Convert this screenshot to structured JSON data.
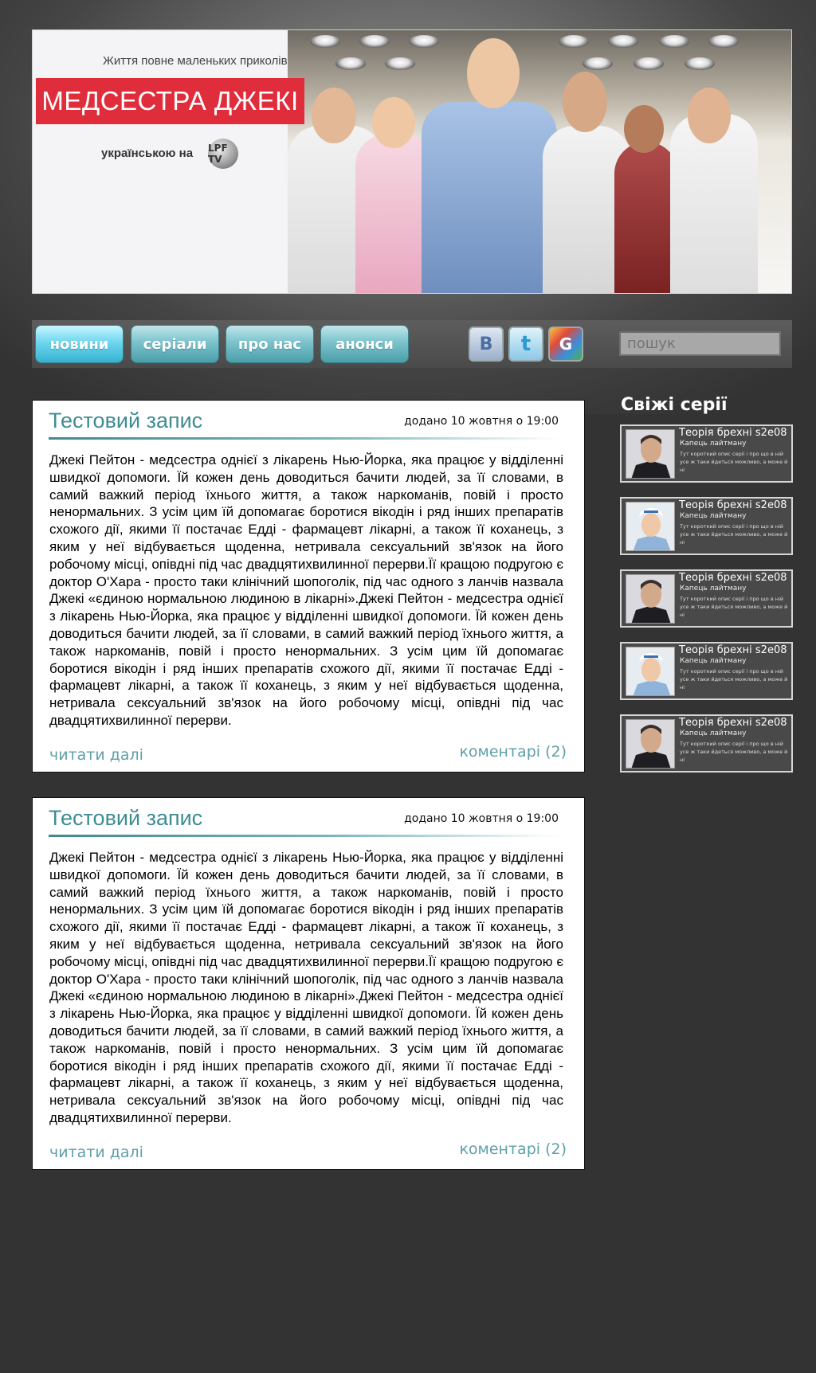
{
  "banner": {
    "tagline": "Життя повне маленьких приколів",
    "logo": "МЕДСЕСТРА ДЖЕКІ",
    "subtitle": "українською на",
    "channel": "LPF TV"
  },
  "nav": {
    "items": [
      {
        "label": "новини"
      },
      {
        "label": "серіали"
      },
      {
        "label": "про нас"
      },
      {
        "label": "анонси"
      }
    ],
    "social": [
      "В",
      "t",
      "G"
    ],
    "search_placeholder": "пошук"
  },
  "posts": [
    {
      "title": "Тестовий запис",
      "date": "додано 10 жовтня о 19:00",
      "text": "Джекі Пейтон - медсестра однієї з лікарень Нью-Йорка, яка працює у відділенні швидкої допомоги. Їй кожен день доводиться бачити людей, за її словами, в самий важкий період їхнього життя, а також наркоманів, повій і просто ненормальних. З усім цим їй допомагає боротися вікодін і ряд інших препаратів схожого дії, якими її постачає Едді - фармацевт лікарні, а також її коханець, з яким у неї відбувається щоденна, нетривала сексуальний зв'язок на його робочому місці, опівдні під час двадцятихвилинної перерви.Її кращою подругою є доктор О'Хара - просто таки клінічний шопоголік, під час одного з ланчів назвала Джекі «єдиною нормальною людиною в лікарні».Джекі Пейтон - медсестра однієї з лікарень Нью-Йорка, яка працює у відділенні швидкої допомоги. Їй кожен день доводиться бачити людей, за її словами, в самий важкий період їхнього життя, а також наркоманів, повій і просто ненормальних. З усім цим їй допомагає боротися вікодін і ряд інших препаратів схожого дії, якими її постачає Едді - фармацевт лікарні, а також її коханець, з яким у неї відбувається щоденна, нетривала сексуальний зв'язок на його робочому місці, опівдні під час двадцятихвилинної перерви.",
      "read_more": "читати далі",
      "comments": "коментарі (2)"
    },
    {
      "title": "Тестовий запис",
      "date": "додано 10 жовтня о 19:00",
      "text": "Джекі Пейтон - медсестра однієї з лікарень Нью-Йорка, яка працює у відділенні швидкої допомоги. Їй кожен день доводиться бачити людей, за її словами, в самий важкий період їхнього життя, а також наркоманів, повій і просто ненормальних. З усім цим їй допомагає боротися вікодін і ряд інших препаратів схожого дії, якими її постачає Едді - фармацевт лікарні, а також її коханець, з яким у неї відбувається щоденна, нетривала сексуальний зв'язок на його робочому місці, опівдні під час двадцятихвилинної перерви.Її кращою подругою є доктор О'Хара - просто таки клінічний шопоголік, під час одного з ланчів назвала Джекі «єдиною нормальною людиною в лікарні».Джекі Пейтон - медсестра однієї з лікарень Нью-Йорка, яка працює у відділенні швидкої допомоги. Їй кожен день доводиться бачити людей, за її словами, в самий важкий період їхнього життя, а також наркоманів, повій і просто ненормальних. З усім цим їй допомагає боротися вікодін і ряд інших препаратів схожого дії, якими її постачає Едді - фармацевт лікарні, а також її коханець, з яким у неї відбувається щоденна, нетривала сексуальний зв'язок на його робочому місці, опівдні під час двадцятихвилинної перерви.",
      "read_more": "читати далі",
      "comments": "коментарі (2)"
    }
  ],
  "sidebar": {
    "title": "Свіжі серії",
    "episodes": [
      {
        "title": "Теорія брехні s2e08",
        "subtitle": "Капець лайтману",
        "desc": "Тут короткий опис серії і про що в ній усе ж таки йдеться можливо, а може й ні",
        "thumb": "man"
      },
      {
        "title": "Теорія брехні s2e08",
        "subtitle": "Капець лайтману",
        "desc": "Тут короткий опис серії і про що в ній усе ж таки йдеться можливо, а може й ні",
        "thumb": "nurse"
      },
      {
        "title": "Теорія брехні s2e08",
        "subtitle": "Капець лайтману",
        "desc": "Тут короткий опис серії і про що в ній усе ж таки йдеться можливо, а може й ні",
        "thumb": "man"
      },
      {
        "title": "Теорія брехні s2e08",
        "subtitle": "Капець лайтману",
        "desc": "Тут короткий опис серії і про що в ній усе ж таки йдеться можливо, а може й ні",
        "thumb": "nurse"
      },
      {
        "title": "Теорія брехні s2e08",
        "subtitle": "Капець лайтману",
        "desc": "Тут короткий опис серії і про що в ній усе ж таки йдеться можливо, а може й ні",
        "thumb": "man"
      }
    ]
  },
  "colors": {
    "background": "#333333",
    "accent": "#3f8c93",
    "nav_button": "#7bc3cd",
    "logo_red": "#e02d3c"
  }
}
